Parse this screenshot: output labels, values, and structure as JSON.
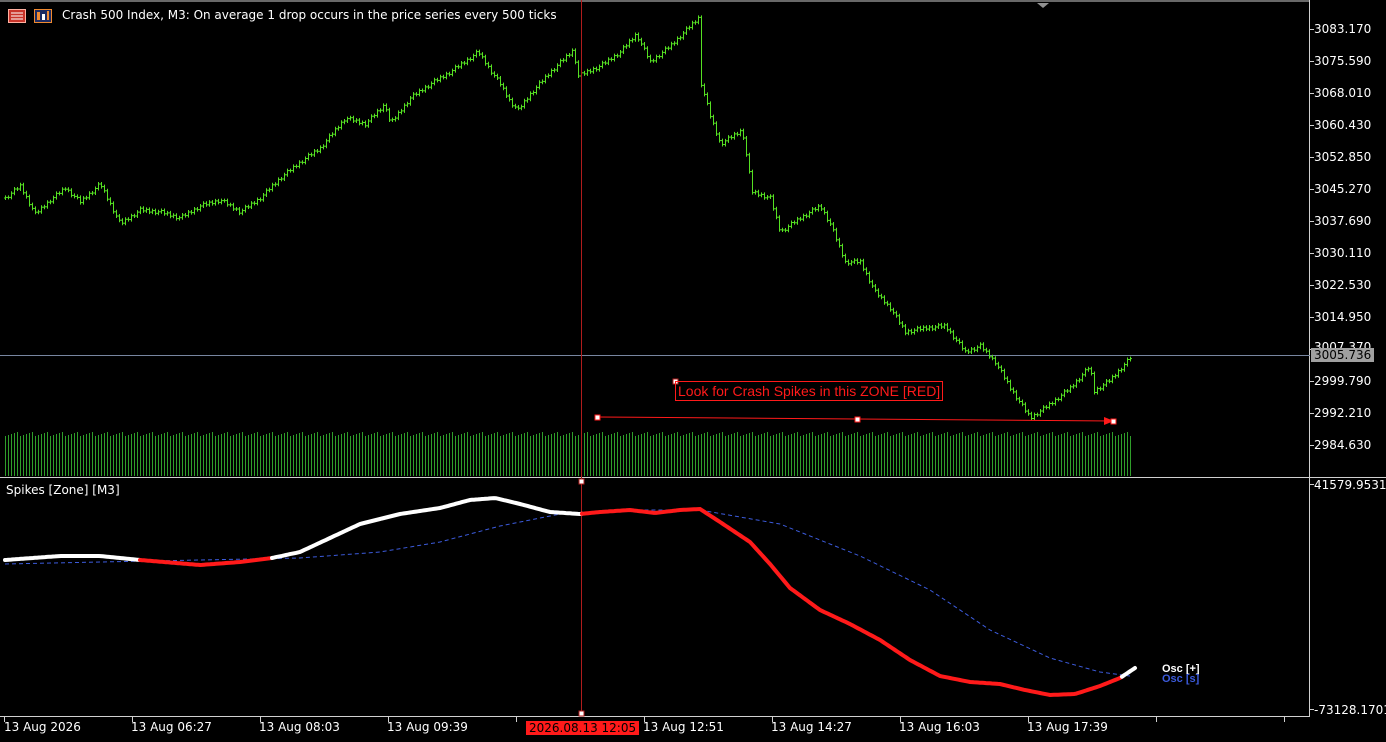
{
  "header": {
    "title": "Crash 500 Index, M3:  On average 1 drop occurs in the price series every 500 ticks"
  },
  "main_chart": {
    "price_axis_labels": [
      "3083.170",
      "3075.590",
      "3068.010",
      "3060.430",
      "3052.850",
      "3045.270",
      "3037.690",
      "3030.110",
      "3022.530",
      "3014.950",
      "3007.370",
      "2999.790",
      "2992.210",
      "2984.630"
    ],
    "current_price": "3005.736",
    "zone_label": "Look for Crash Spikes in this ZONE [RED]",
    "price_path": [
      [
        5,
        198
      ],
      [
        20,
        186
      ],
      [
        35,
        214
      ],
      [
        50,
        200
      ],
      [
        65,
        188
      ],
      [
        80,
        202
      ],
      [
        100,
        184
      ],
      [
        120,
        224
      ],
      [
        140,
        210
      ],
      [
        160,
        212
      ],
      [
        180,
        218
      ],
      [
        200,
        206
      ],
      [
        220,
        200
      ],
      [
        240,
        212
      ],
      [
        260,
        198
      ],
      [
        280,
        178
      ],
      [
        300,
        162
      ],
      [
        320,
        148
      ],
      [
        345,
        118
      ],
      [
        365,
        124
      ],
      [
        385,
        104
      ],
      [
        390,
        124
      ],
      [
        410,
        98
      ],
      [
        430,
        84
      ],
      [
        450,
        72
      ],
      [
        478,
        52
      ],
      [
        490,
        70
      ],
      [
        500,
        84
      ],
      [
        510,
        102
      ],
      [
        518,
        110
      ],
      [
        530,
        94
      ],
      [
        550,
        72
      ],
      [
        573,
        50
      ],
      [
        578,
        76
      ],
      [
        600,
        66
      ],
      [
        620,
        52
      ],
      [
        636,
        34
      ],
      [
        650,
        62
      ],
      [
        670,
        46
      ],
      [
        698,
        18
      ],
      [
        700,
        80
      ],
      [
        710,
        116
      ],
      [
        720,
        144
      ],
      [
        742,
        130
      ],
      [
        752,
        192
      ],
      [
        770,
        198
      ],
      [
        780,
        232
      ],
      [
        800,
        218
      ],
      [
        820,
        206
      ],
      [
        830,
        224
      ],
      [
        845,
        262
      ],
      [
        860,
        262
      ],
      [
        875,
        292
      ],
      [
        890,
        308
      ],
      [
        905,
        332
      ],
      [
        925,
        328
      ],
      [
        945,
        326
      ],
      [
        965,
        352
      ],
      [
        980,
        346
      ],
      [
        995,
        362
      ],
      [
        1010,
        388
      ],
      [
        1030,
        418
      ],
      [
        1050,
        404
      ],
      [
        1070,
        388
      ],
      [
        1090,
        366
      ],
      [
        1093,
        392
      ],
      [
        1110,
        380
      ],
      [
        1130,
        358
      ]
    ],
    "trendline": [
      [
        597,
        417
      ],
      [
        857,
        419
      ],
      [
        1113,
        421
      ]
    ]
  },
  "sub_window": {
    "title": "Spikes [Zone] [M3]",
    "axis_top": "41579.9531",
    "axis_bottom": "-73128.1701",
    "legend": [
      {
        "label": "Osc [+]",
        "color": "#ffffff"
      },
      {
        "label": "Osc [s]",
        "color": "#3c5bdc"
      }
    ],
    "osc_path": [
      [
        5,
        560
      ],
      [
        60,
        556
      ],
      [
        100,
        556
      ],
      [
        140,
        560
      ],
      [
        200,
        565
      ],
      [
        240,
        562
      ],
      [
        272,
        558
      ],
      [
        300,
        552
      ],
      [
        330,
        538
      ],
      [
        360,
        524
      ],
      [
        400,
        514
      ],
      [
        440,
        508
      ],
      [
        470,
        500
      ],
      [
        495,
        498
      ],
      [
        520,
        504
      ],
      [
        550,
        512
      ],
      [
        580,
        514
      ],
      [
        600,
        512
      ],
      [
        630,
        510
      ],
      [
        655,
        513
      ],
      [
        680,
        510
      ],
      [
        700,
        509
      ],
      [
        720,
        522
      ],
      [
        750,
        542
      ],
      [
        770,
        564
      ],
      [
        790,
        588
      ],
      [
        820,
        610
      ],
      [
        850,
        624
      ],
      [
        880,
        640
      ],
      [
        910,
        660
      ],
      [
        940,
        676
      ],
      [
        970,
        682
      ],
      [
        1000,
        684
      ],
      [
        1025,
        690
      ],
      [
        1050,
        695
      ],
      [
        1075,
        694
      ],
      [
        1100,
        686
      ],
      [
        1120,
        678
      ],
      [
        1135,
        668
      ]
    ],
    "osc_color_segments": [
      {
        "from": 5,
        "to": 140,
        "color": "#ffffff"
      },
      {
        "from": 140,
        "to": 272,
        "color": "#ff1a1a"
      },
      {
        "from": 272,
        "to": 582,
        "color": "#ffffff"
      },
      {
        "from": 582,
        "to": 1122,
        "color": "#ff1a1a"
      },
      {
        "from": 1122,
        "to": 1135,
        "color": "#ffffff"
      }
    ],
    "signal_path": [
      [
        5,
        564
      ],
      [
        100,
        562
      ],
      [
        200,
        560
      ],
      [
        300,
        558
      ],
      [
        380,
        552
      ],
      [
        440,
        542
      ],
      [
        500,
        526
      ],
      [
        560,
        514
      ],
      [
        620,
        510
      ],
      [
        700,
        510
      ],
      [
        780,
        524
      ],
      [
        860,
        556
      ],
      [
        930,
        590
      ],
      [
        990,
        630
      ],
      [
        1050,
        658
      ],
      [
        1100,
        672
      ],
      [
        1130,
        676
      ]
    ]
  },
  "time_axis": {
    "labels": [
      "13 Aug 2026",
      "13 Aug 06:27",
      "13 Aug 08:03",
      "13 Aug 09:39",
      "13 Aug 12:51",
      "13 Aug 14:27",
      "13 Aug 16:03",
      "13 Aug 17:39"
    ],
    "crosshair_time": "2026.08.13 12:05"
  },
  "colors": {
    "background": "#000000",
    "candle": "#55e022",
    "volume": "#2f9e2a",
    "crosshair": "#b01c1c",
    "price_line": "#7886a0",
    "zone_red": "#ff1a1a",
    "signal_blue": "#3c5bdc",
    "axis": "#d0d0d0"
  },
  "icons": [
    "bars-icon",
    "indicator-icon"
  ]
}
